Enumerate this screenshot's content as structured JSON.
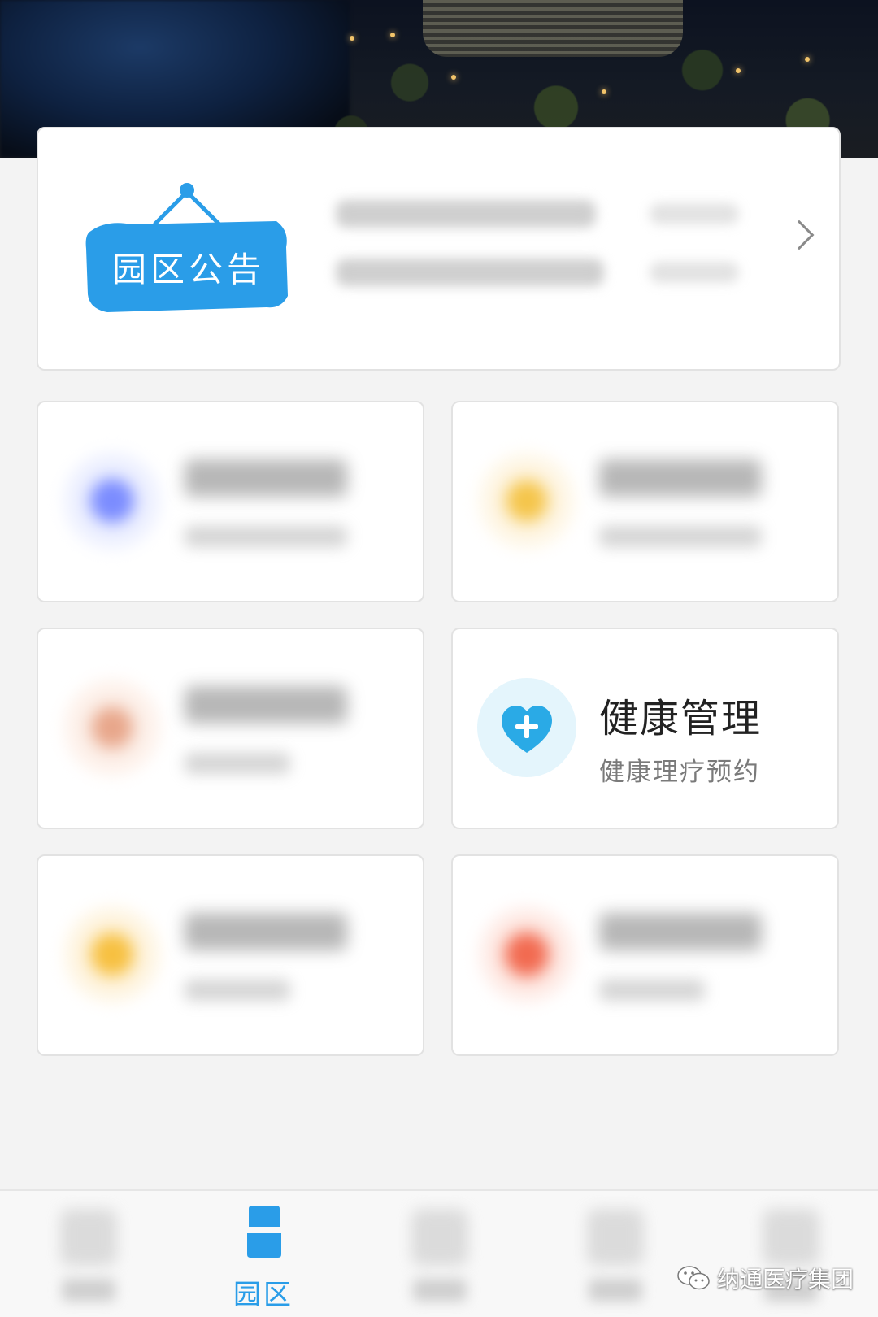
{
  "notice": {
    "tag_text": "园区公告",
    "tag_color": "#2a9de8"
  },
  "health_tile": {
    "title": "健康管理",
    "subtitle": "健康理疗预约",
    "icon": "heart-plus-icon",
    "accent": "#2aaae6"
  },
  "blurred_tile_colors": [
    "#7b8cff",
    "#f5c54a",
    "#e8a68a",
    "#f7c040",
    "#f26a50"
  ],
  "tabbar": {
    "active_label": "园区",
    "active_color": "#2a9de8"
  },
  "watermark": {
    "text": "纳通医疗集团",
    "icon": "wechat-icon"
  }
}
